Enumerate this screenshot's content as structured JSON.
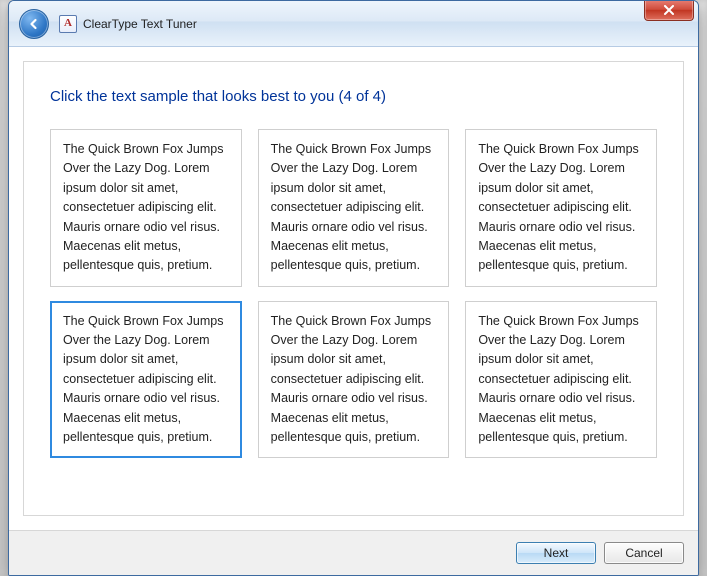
{
  "window": {
    "title": "ClearType Text Tuner",
    "icon_letter": "A"
  },
  "heading": "Click the text sample that looks best to you (4 of 4)",
  "sample_text": "The Quick Brown Fox Jumps Over the Lazy Dog. Lorem ipsum dolor sit amet, consectetuer adipiscing elit. Mauris ornare odio vel risus. Maecenas elit metus, pellentesque quis, pretium.",
  "samples": [
    {
      "selected": false
    },
    {
      "selected": false
    },
    {
      "selected": false
    },
    {
      "selected": true
    },
    {
      "selected": false
    },
    {
      "selected": false
    }
  ],
  "buttons": {
    "next": "Next",
    "cancel": "Cancel"
  }
}
